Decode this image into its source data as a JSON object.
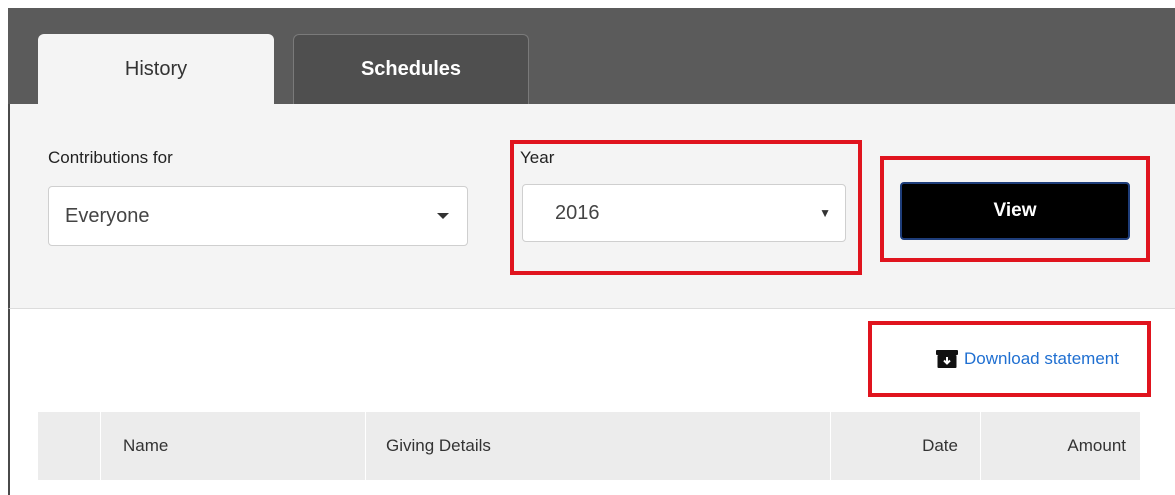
{
  "tabs": [
    {
      "label": "History",
      "active": true
    },
    {
      "label": "Schedules",
      "active": false
    }
  ],
  "filters": {
    "contributions_label": "Contributions for",
    "contributions_value": "Everyone",
    "year_label": "Year",
    "year_value": "2016",
    "view_label": "View"
  },
  "download": {
    "label": "Download statement",
    "icon": "archive-download-icon"
  },
  "table": {
    "columns": [
      "",
      "Name",
      "Giving Details",
      "Date",
      "Amount"
    ]
  },
  "colors": {
    "highlight": "#e0141e",
    "link": "#1f6fd1",
    "button_bg": "#000000",
    "tabbar_bg": "#5b5b5b"
  }
}
